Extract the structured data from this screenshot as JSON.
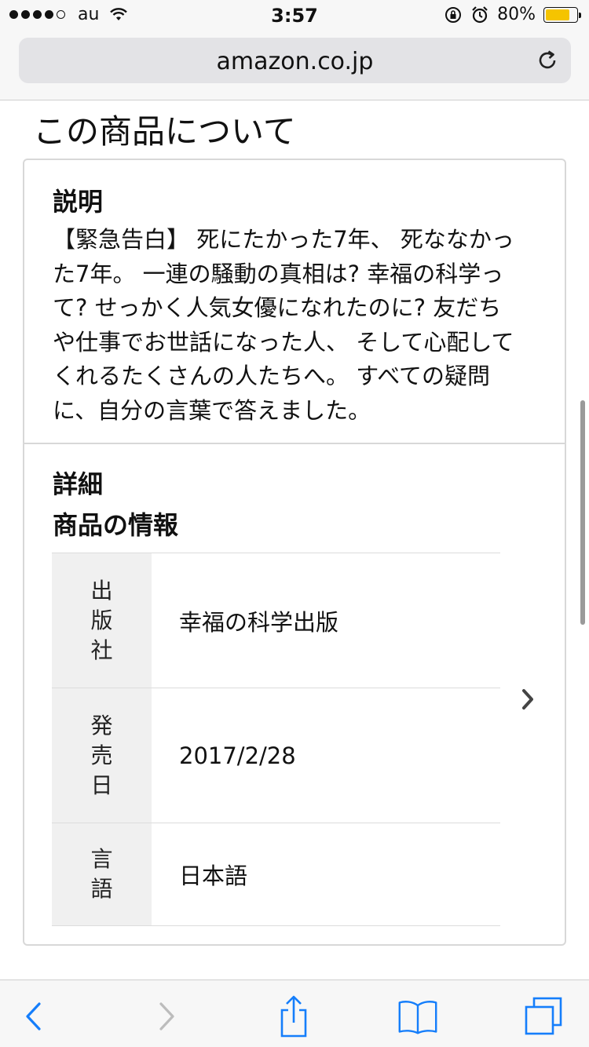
{
  "status_bar": {
    "carrier": "au",
    "time": "3:57",
    "battery_percent": "80%",
    "battery_level": 0.8,
    "signal_bars_filled": 4,
    "signal_bars_total": 5
  },
  "browser": {
    "url": "amazon.co.jp"
  },
  "page": {
    "section_title": "この商品について",
    "description": {
      "heading": "説明",
      "lines": [
        "【緊急告白】 死にたかった7年、 死ななかっ",
        "た7年。 一連の騒動の真相は? 幸福の科学っ",
        "て? せっかく人気女優になれたのに? 友だち",
        "や仕事でお世話になった人、 そして心配して",
        "くれるたくさんの人たちへ。 すべての疑問",
        "に、自分の言葉で答えました。"
      ]
    },
    "details": {
      "heading": "詳細",
      "subheading": "商品の情報",
      "rows": [
        {
          "key_chars": [
            "出",
            "版",
            "社"
          ],
          "value": "幸福の科学出版"
        },
        {
          "key_chars": [
            "発",
            "売",
            "日"
          ],
          "value": "2017/2/28"
        },
        {
          "key_chars": [
            "言",
            "語"
          ],
          "value": "日本語"
        }
      ]
    }
  },
  "colors": {
    "link_blue": "#157efb",
    "battery_fill": "#f5c400"
  }
}
